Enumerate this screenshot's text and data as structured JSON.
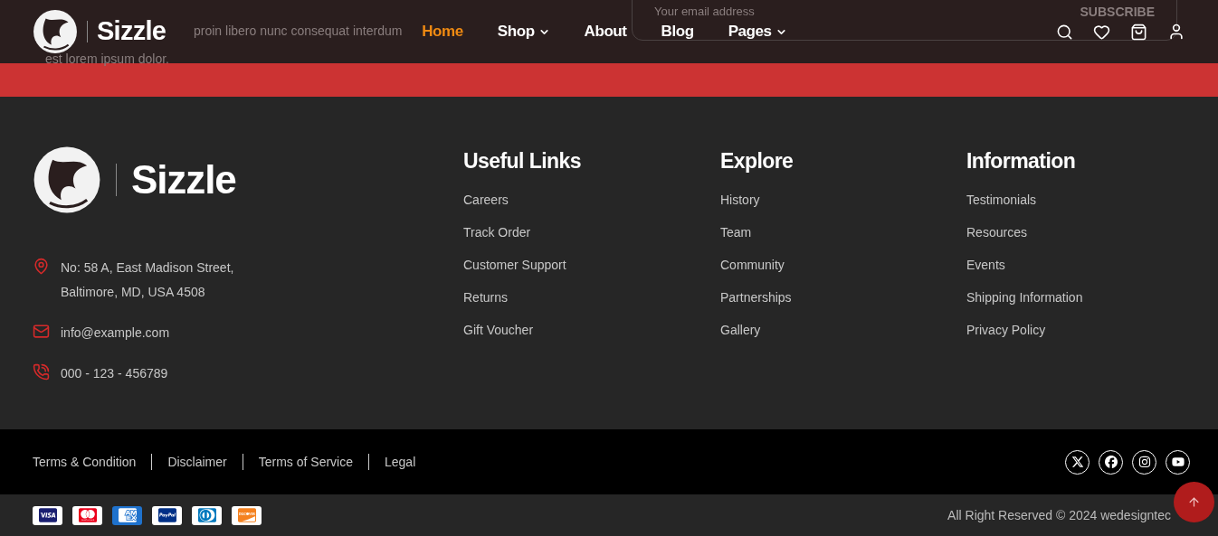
{
  "backdrop": {
    "paragraph_parts": [
      "proin libero nunc consequat interdum",
      "est lorem ipsum dolor."
    ],
    "email_field": {
      "placeholder": "Your email address"
    },
    "subscribe_button": "SUBSCRIBE"
  },
  "header": {
    "logo": "Sizzle",
    "nav": [
      {
        "label": "Home",
        "selected": true,
        "dropdown": false
      },
      {
        "label": "Shop",
        "selected": false,
        "dropdown": true
      },
      {
        "label": "About",
        "selected": false,
        "dropdown": false
      },
      {
        "label": "Blog",
        "selected": false,
        "dropdown": false
      },
      {
        "label": "Pages",
        "selected": false,
        "dropdown": true
      }
    ]
  },
  "footer": {
    "logo": "Sizzle",
    "contacts": [
      {
        "kind": "address",
        "lines": [
          "No: 58 A, East Madison Street,",
          "Baltimore, MD, USA 4508"
        ]
      },
      {
        "kind": "email",
        "lines": [
          "info@example.com"
        ]
      },
      {
        "kind": "phone",
        "lines": [
          "000 - 123 - 456789"
        ]
      }
    ],
    "columns": [
      {
        "title": "Useful Links",
        "links": [
          "Careers",
          "Track Order",
          "Customer Support",
          "Returns",
          "Gift Voucher"
        ]
      },
      {
        "title": "Explore",
        "links": [
          "History",
          "Team",
          "Community",
          "Partnerships",
          "Gallery"
        ]
      },
      {
        "title": "Information",
        "links": [
          "Testimonials",
          "Resources",
          "Events",
          "Shipping Information",
          "Privacy Policy"
        ]
      }
    ]
  },
  "legal_links": [
    "Terms & Condition",
    "Disclaimer",
    "Terms of Service",
    "Legal"
  ],
  "social": [
    {
      "kind": "x"
    },
    {
      "kind": "facebook"
    },
    {
      "kind": "instagram"
    },
    {
      "kind": "youtube"
    }
  ],
  "payments": [
    {
      "kind": "visa"
    },
    {
      "kind": "mastercard"
    },
    {
      "kind": "amex"
    },
    {
      "kind": "paypal"
    },
    {
      "kind": "diners"
    },
    {
      "kind": "discover"
    }
  ],
  "copyright": "All Right Reserved © 2024 wedesigntec"
}
